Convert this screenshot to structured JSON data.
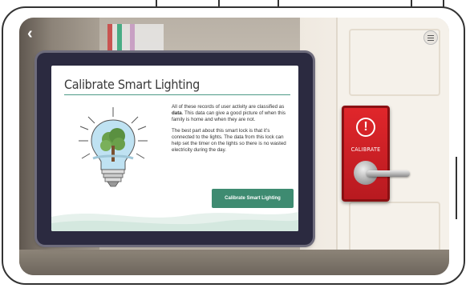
{
  "navigation": {
    "back_icon": "chevron-left-icon",
    "menu_icon": "hamburger-menu-icon"
  },
  "card": {
    "title": "Calibrate Smart Lighting",
    "paragraph1_pre": "All of these records of user activity are classified as ",
    "paragraph1_bold": "data",
    "paragraph1_post": ". This data can give a good picture of when this family is home and when they are not.",
    "paragraph2": "The best part about this smart lock is that it’s connected to the lights. The data from this lock can help set the timer on the lights so there is no wasted electricity during the day.",
    "button_label": "Calibrate Smart Lighting",
    "illustration_icon": "lightbulb-tree-icon"
  },
  "lock_plate": {
    "icon": "alert-icon",
    "label": "CALIBRATE",
    "handle_icon": "door-handle-icon"
  },
  "colors": {
    "accent": "#3e8b71",
    "plate_red": "#e0262b",
    "tablet_frame": "#2b2a40"
  }
}
